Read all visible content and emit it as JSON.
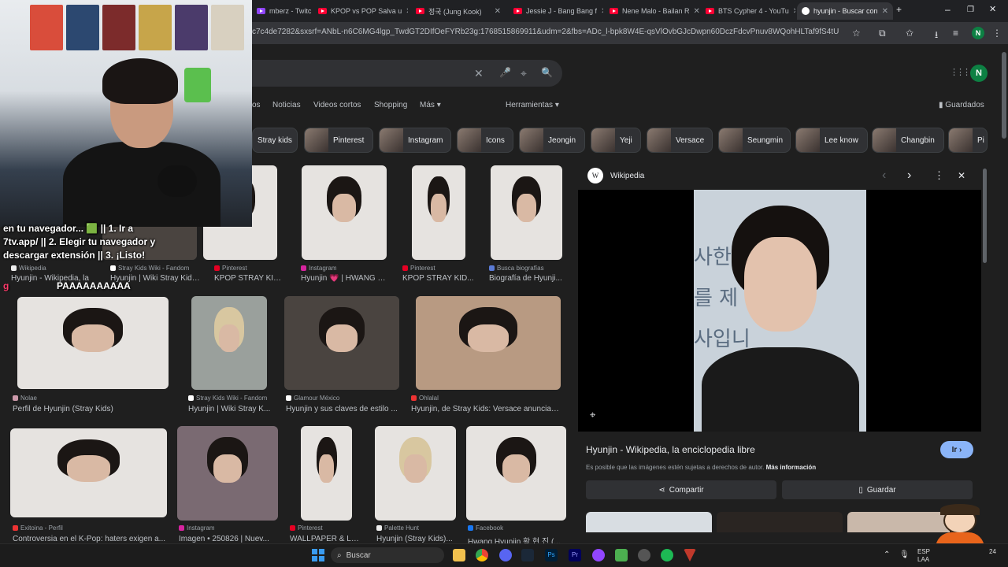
{
  "browser": {
    "tabs": [
      {
        "label": "mberz - Twitch",
        "type": "twitch"
      },
      {
        "label": "KPOP vs POP Salva u",
        "type": "yt"
      },
      {
        "label": "정국 (Jung Kook)",
        "type": "yt"
      },
      {
        "label": "Jessie J - Bang Bang f",
        "type": "yt"
      },
      {
        "label": "Nene Malo - Bailan R",
        "type": "yt"
      },
      {
        "label": "BTS Cypher 4 - YouTu",
        "type": "yt"
      },
      {
        "label": "hyunjin - Buscar con",
        "type": "google",
        "active": true
      }
    ],
    "new_tab": "+",
    "window_controls": [
      "–",
      "❐",
      "✕"
    ],
    "url": "c7c4de7282&sxsrf=ANbL-n6C6MG4lgp_TwdGT2DIfOeFYRb23g:1768515869911&udm=2&fbs=ADc_l-bpk8W4E-qsVlOvbGJcDwpn60DczFdcvPnuv8WQohHLTaf9fS4tU71bi2aHS-Pme...",
    "profile_initial": "N"
  },
  "search": {
    "clear": "✕",
    "mic": "🎤",
    "lens": "⌖",
    "search": "🔍",
    "apps": "⋮⋮⋮",
    "avatar": "N",
    "nav": [
      "os",
      "Noticias",
      "Videos cortos",
      "Shopping",
      "Más",
      "Herramientas"
    ],
    "saved": "Guardados",
    "chips": [
      "Stray kids",
      "Pinterest",
      "Instagram",
      "Icons",
      "Jeongin",
      "Yeji",
      "Versace",
      "Seungmin",
      "Lee know",
      "Changbin",
      "Pi"
    ]
  },
  "results": {
    "row1": [
      {
        "src": "Wikipedia",
        "cap": "Hyunjin - Wikipedia, la"
      },
      {
        "src": "Stray Kids Wiki - Fandom",
        "cap": "Hyunjin | Wiki Stray Kids..."
      },
      {
        "src": "Pinterest",
        "cap": "KPOP STRAY KID..."
      },
      {
        "src": "Instagram",
        "cap": "Hyunjin 💗 | HWANG H..."
      },
      {
        "src": "Pinterest",
        "cap": "KPOP STRAY KID..."
      },
      {
        "src": "Busca biografías",
        "cap": "Biografía de Hyunji..."
      }
    ],
    "row2": [
      {
        "src": "Nolae",
        "cap": "Perfil de Hyunjin (Stray Kids)"
      },
      {
        "src": "Stray Kids Wiki - Fandom",
        "cap": "Hyunjin | Wiki Stray K..."
      },
      {
        "src": "Glamour México",
        "cap": "Hyunjin y sus claves de estilo ..."
      },
      {
        "src": "Ohlalal",
        "cap": "Hyunjin, de Stray Kids: Versace anuncia c..."
      }
    ],
    "row3": [
      {
        "src": "Exitoina - Perfil",
        "cap": "Controversia en el K-Pop: haters exigen a..."
      },
      {
        "src": "Instagram",
        "cap": "Imagen • 250826 | Nuev..."
      },
      {
        "src": "Pinterest",
        "cap": "WALLPAPER & LO..."
      },
      {
        "src": "Palette Hunt",
        "cap": "Hyunjin (Stray Kids)..."
      },
      {
        "src": "Facebook",
        "cap": "Hwang Hyunjin 황 현 진 (..."
      }
    ]
  },
  "panel": {
    "source": "Wikipedia",
    "logo": "W",
    "title": "Hyunjin - Wikipedia, la enciclopedia libre",
    "go": "Ir ›",
    "notice": "Es posible que las imágenes estén sujetas a derechos de autor.",
    "more": "Más información",
    "share": "Compartir",
    "save": "Guardar",
    "prev": "‹",
    "next": "›",
    "menu": "⋮",
    "close": "✕",
    "sign_text": "사한\n를 제\n사입니"
  },
  "overlay": {
    "chat_lines": [
      "en tu navegador... 🟩 || 1. Ir a",
      "7tv.app/ || 2. Elegir tu navegador y",
      "descargar extensión || 3. ¡Listo!"
    ],
    "chat_user": "g",
    "chat_msg": "PAAAAAAAAAA"
  },
  "taskbar": {
    "search": "Buscar",
    "lang": "ESP",
    "lang2": "LAA",
    "time": "24"
  }
}
